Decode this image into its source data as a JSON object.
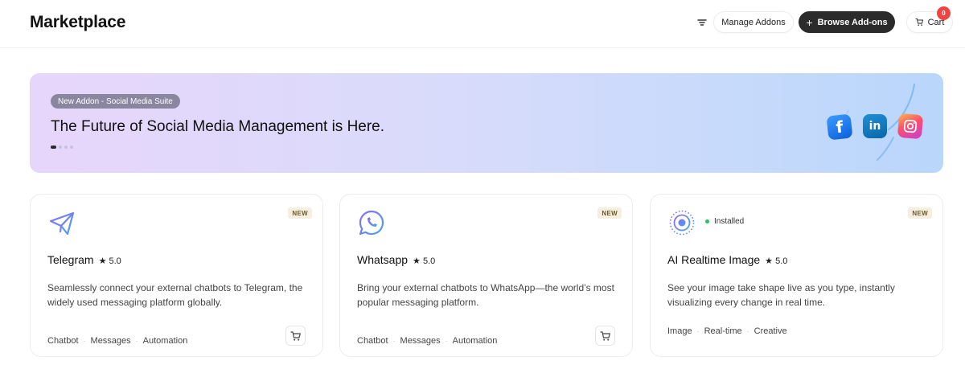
{
  "header": {
    "title": "Marketplace",
    "manage_label": "Manage Addons",
    "browse_label": "Browse Add-ons",
    "browse_icon": "+",
    "cart_label": "Cart",
    "cart_count": "0"
  },
  "banner": {
    "badge": "New Addon - Social Media Suite",
    "title": "The Future of Social Media Management is Here.",
    "slides": 4,
    "active_slide": 1,
    "icons": [
      "facebook-icon",
      "linkedin-icon",
      "instagram-icon"
    ],
    "fb_glyph": "f",
    "li_glyph": "in"
  },
  "cards": [
    {
      "title": "Telegram",
      "rating": "★ 5.0",
      "badge": "NEW",
      "description": "Seamlessly connect your external chatbots to Telegram, the widely used messaging platform globally.",
      "tags": [
        "Chatbot",
        "Messages",
        "Automation"
      ],
      "icon": "telegram-icon"
    },
    {
      "title": "Whatsapp",
      "rating": "★ 5.0",
      "badge": "NEW",
      "description": "Bring your external chatbots to WhatsApp—the world’s most popular messaging platform.",
      "tags": [
        "Chatbot",
        "Messages",
        "Automation"
      ],
      "icon": "whatsapp-icon"
    },
    {
      "title": "AI Realtime Image",
      "rating": "★ 5.0",
      "badge": "NEW",
      "status": "Installed",
      "description": "See your image take shape live as you type, instantly visualizing every change in real time.",
      "tags": [
        "Image",
        "Real-time",
        "Creative"
      ],
      "icon": "realtime-image-icon"
    }
  ],
  "colors": {
    "primary_dark": "#2b2b2b",
    "badge_red": "#ef4444",
    "installed_green": "#22c55e",
    "accent_purple": "#7c7cf0"
  }
}
